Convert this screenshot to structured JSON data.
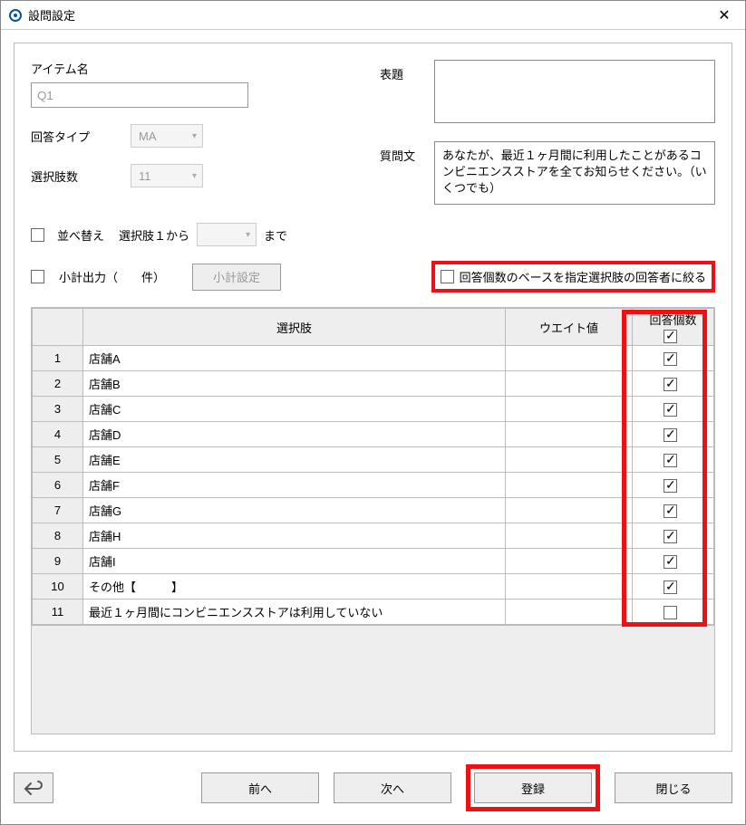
{
  "window": {
    "title": "設問設定"
  },
  "labels": {
    "item_name": "アイテム名",
    "answer_type": "回答タイプ",
    "choice_count": "選択肢数",
    "sort": "並べ替え",
    "sort_from": "選択肢１から",
    "sort_to": "まで",
    "subtotal_out": "小計出力（　　件）",
    "subtotal_btn": "小計設定",
    "base_filter": "回答個数のベースを指定選択肢の回答者に絞る",
    "title_label": "表題",
    "question_label": "質問文"
  },
  "values": {
    "item_name": "Q1",
    "answer_type": "MA",
    "choice_count": "11",
    "sort_input": "",
    "title_text": "",
    "question_text": "あなたが、最近１ヶ月間に利用したことがあるコンビニエンスストアを全てお知らせください。（いくつでも）"
  },
  "table": {
    "headers": {
      "choice": "選択肢",
      "weight": "ウエイト値",
      "count": "回答個数"
    },
    "header_checked": true,
    "rows": [
      {
        "n": "1",
        "label": "店舗A",
        "checked": true
      },
      {
        "n": "2",
        "label": "店舗B",
        "checked": true
      },
      {
        "n": "3",
        "label": "店舗C",
        "checked": true
      },
      {
        "n": "4",
        "label": "店舗D",
        "checked": true
      },
      {
        "n": "5",
        "label": "店舗E",
        "checked": true
      },
      {
        "n": "6",
        "label": "店舗F",
        "checked": true
      },
      {
        "n": "7",
        "label": "店舗G",
        "checked": true
      },
      {
        "n": "8",
        "label": "店舗H",
        "checked": true
      },
      {
        "n": "9",
        "label": "店舗I",
        "checked": true
      },
      {
        "n": "10",
        "label": "その他【　　　】",
        "checked": true
      },
      {
        "n": "11",
        "label": "最近１ヶ月間にコンビニエンスストアは利用していない",
        "checked": false
      }
    ]
  },
  "buttons": {
    "prev": "前へ",
    "next": "次へ",
    "register": "登録",
    "close": "閉じる"
  }
}
